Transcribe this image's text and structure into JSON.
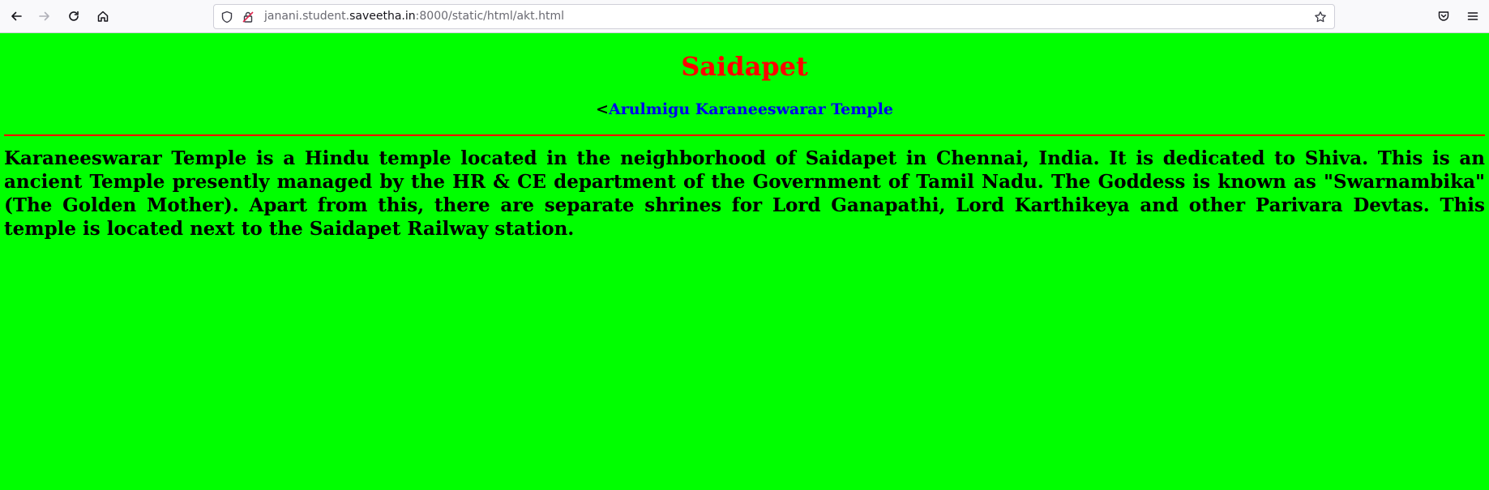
{
  "browser": {
    "url_prefix": "janani.student.",
    "url_domain": "saveetha.in",
    "url_suffix": ":8000/static/html/akt.html",
    "icons": {
      "back": "back-arrow-icon",
      "forward": "forward-arrow-icon",
      "reload": "reload-icon",
      "home": "home-icon",
      "shield": "shield-icon",
      "lock": "page-info-icon",
      "bookmark": "star-icon",
      "pocket": "pocket-icon",
      "menu": "hamburger-menu-icon"
    }
  },
  "page": {
    "background_color": "#00ff00",
    "title": "Saidapet",
    "title_color": "#ff0000",
    "back_prefix": "<",
    "back_link_label": "Arulmigu Karaneeswarar Temple",
    "link_color": "#0000ee",
    "divider_color": "#ff0000",
    "body_text": "Karaneeswarar Temple is a Hindu temple located in the neighborhood of Saidapet in Chennai, India. It is dedicated to Shiva. This is an ancient Temple presently managed by the HR & CE department of the Government of Tamil Nadu. The Goddess is known as \"Swarnambika\" (The Golden Mother). Apart from this, there are separate shrines for Lord Ganapathi, Lord Karthikeya and other Parivara Devtas. This temple is located next to the Saidapet Railway station."
  }
}
